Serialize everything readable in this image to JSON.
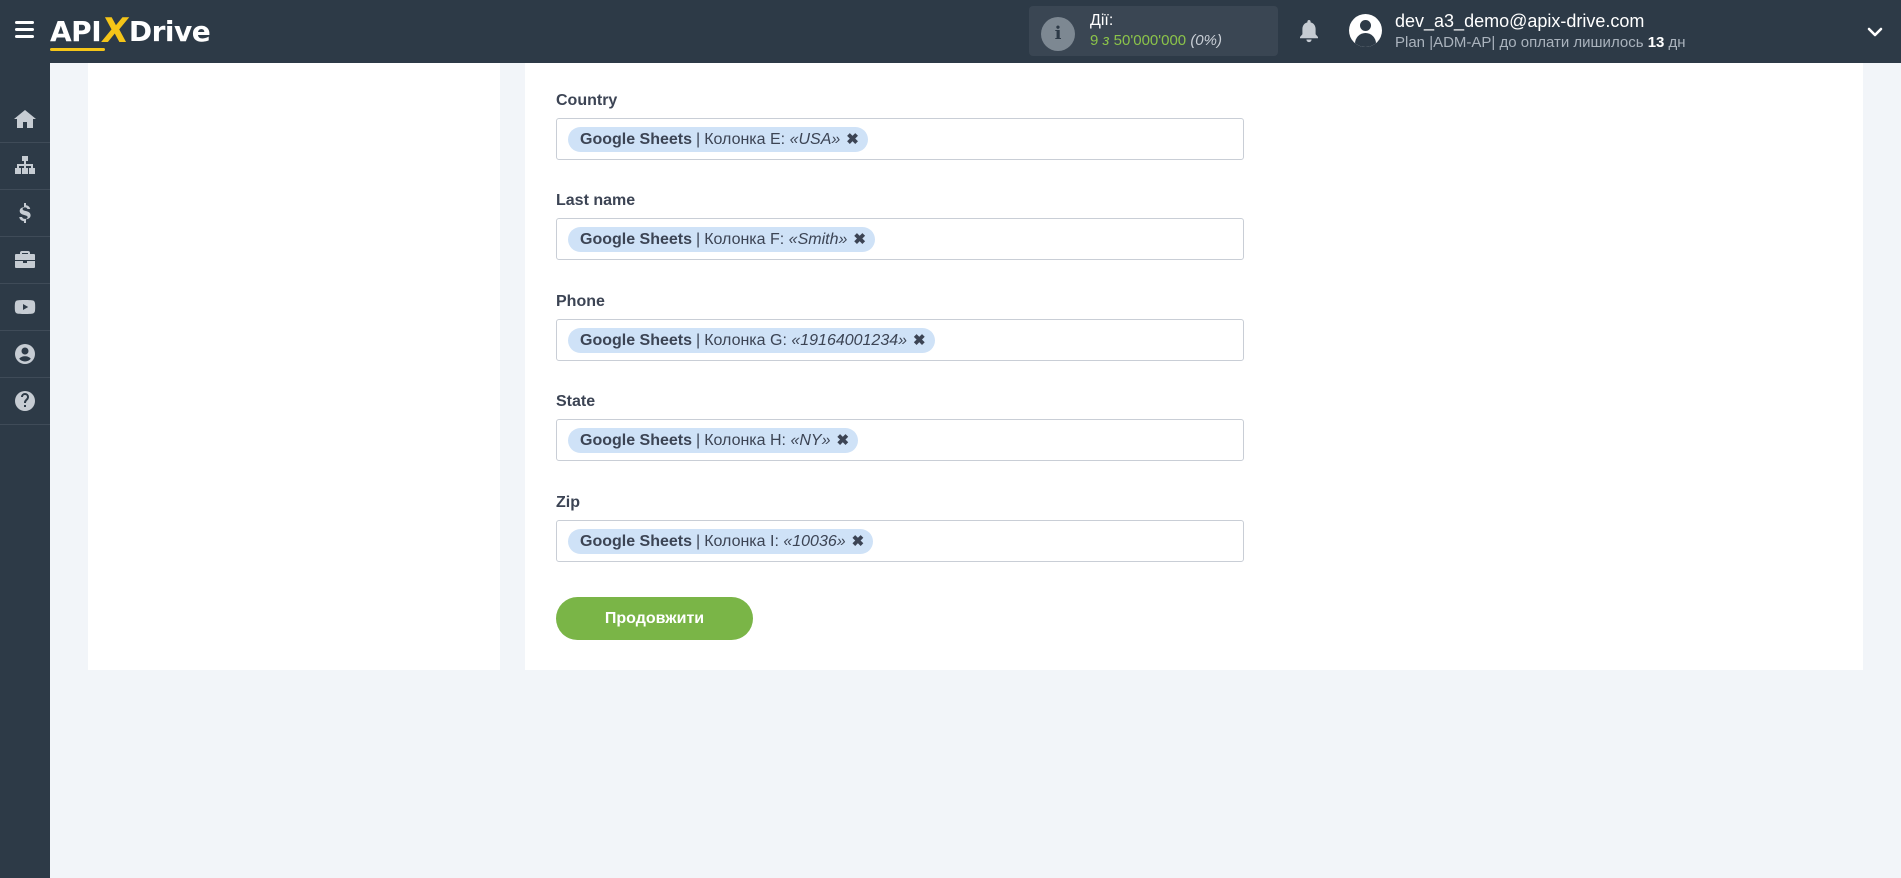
{
  "header": {
    "logo": {
      "part1": "API",
      "part2": "X",
      "part3": "Drive"
    },
    "actions": {
      "label": "Дії:",
      "used": "9",
      "of": "з",
      "limit": "50'000'000",
      "percent": "(0%)"
    },
    "user": {
      "email": "dev_a3_demo@apix-drive.com",
      "plan_prefix": "Plan |ADM-AP| до оплати лишилось ",
      "days": "13",
      "days_unit": " дн"
    }
  },
  "sidebar": {
    "items": [
      {
        "icon": "home-icon"
      },
      {
        "icon": "sitemap-icon"
      },
      {
        "icon": "dollar-icon"
      },
      {
        "icon": "briefcase-icon"
      },
      {
        "icon": "youtube-icon"
      },
      {
        "icon": "user-icon"
      },
      {
        "icon": "help-icon"
      }
    ]
  },
  "fields": [
    {
      "label": "Country",
      "source": "Google Sheets",
      "separator": "|",
      "column": "Колонка E:",
      "value": "«USA»"
    },
    {
      "label": "Last name",
      "source": "Google Sheets",
      "separator": "|",
      "column": "Колонка F:",
      "value": "«Smith»"
    },
    {
      "label": "Phone",
      "source": "Google Sheets",
      "separator": "|",
      "column": "Колонка G:",
      "value": "«19164001234»"
    },
    {
      "label": "State",
      "source": "Google Sheets",
      "separator": "|",
      "column": "Колонка H:",
      "value": "«NY»"
    },
    {
      "label": "Zip",
      "source": "Google Sheets",
      "separator": "|",
      "column": "Колонка I:",
      "value": "«10036»"
    }
  ],
  "continue_button": "Продовжити",
  "colors": {
    "topbar": "#2d3a47",
    "accent_green": "#7ab547",
    "chip_bg": "#cfe2f7",
    "logo_yellow": "#f5c518"
  }
}
